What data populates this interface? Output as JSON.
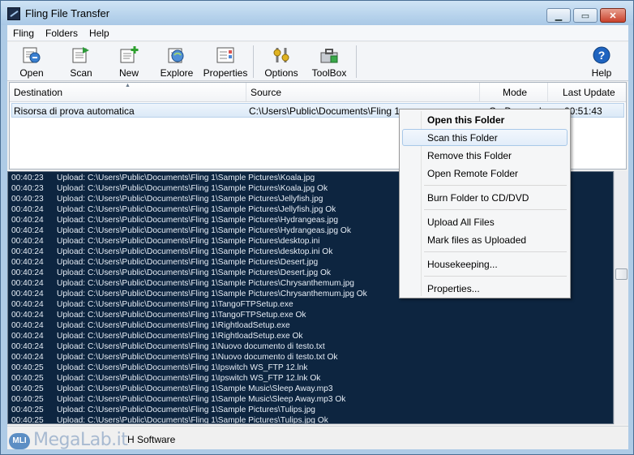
{
  "window": {
    "title": "Fling File Transfer",
    "minimize": "▁",
    "maximize": "▭",
    "close": "✕"
  },
  "menu": [
    "Fling",
    "Folders",
    "Help"
  ],
  "toolbar": {
    "open": "Open",
    "scan": "Scan",
    "new": "New",
    "explore": "Explore",
    "properties": "Properties",
    "options": "Options",
    "toolbox": "ToolBox",
    "help": "Help"
  },
  "folder_list": {
    "columns": [
      "Destination",
      "Source",
      "Mode",
      "Last Update"
    ],
    "rows": [
      {
        "destination": "Risorsa di prova automatica",
        "source": "C:\\Users\\Public\\Documents\\Fling 1",
        "mode": "On Demand",
        "last_update": "00:51:43"
      }
    ]
  },
  "log": [
    [
      "00:40:23",
      "Upload: C:\\Users\\Public\\Documents\\Fling 1\\Sample Pictures\\Koala.jpg"
    ],
    [
      "00:40:23",
      "Upload: C:\\Users\\Public\\Documents\\Fling 1\\Sample Pictures\\Koala.jpg Ok"
    ],
    [
      "00:40:23",
      "Upload: C:\\Users\\Public\\Documents\\Fling 1\\Sample Pictures\\Jellyfish.jpg"
    ],
    [
      "00:40:24",
      "Upload: C:\\Users\\Public\\Documents\\Fling 1\\Sample Pictures\\Jellyfish.jpg Ok"
    ],
    [
      "00:40:24",
      "Upload: C:\\Users\\Public\\Documents\\Fling 1\\Sample Pictures\\Hydrangeas.jpg"
    ],
    [
      "00:40:24",
      "Upload: C:\\Users\\Public\\Documents\\Fling 1\\Sample Pictures\\Hydrangeas.jpg Ok"
    ],
    [
      "00:40:24",
      "Upload: C:\\Users\\Public\\Documents\\Fling 1\\Sample Pictures\\desktop.ini"
    ],
    [
      "00:40:24",
      "Upload: C:\\Users\\Public\\Documents\\Fling 1\\Sample Pictures\\desktop.ini Ok"
    ],
    [
      "00:40:24",
      "Upload: C:\\Users\\Public\\Documents\\Fling 1\\Sample Pictures\\Desert.jpg"
    ],
    [
      "00:40:24",
      "Upload: C:\\Users\\Public\\Documents\\Fling 1\\Sample Pictures\\Desert.jpg Ok"
    ],
    [
      "00:40:24",
      "Upload: C:\\Users\\Public\\Documents\\Fling 1\\Sample Pictures\\Chrysanthemum.jpg"
    ],
    [
      "00:40:24",
      "Upload: C:\\Users\\Public\\Documents\\Fling 1\\Sample Pictures\\Chrysanthemum.jpg Ok"
    ],
    [
      "00:40:24",
      "Upload: C:\\Users\\Public\\Documents\\Fling 1\\TangoFTPSetup.exe"
    ],
    [
      "00:40:24",
      "Upload: C:\\Users\\Public\\Documents\\Fling 1\\TangoFTPSetup.exe Ok"
    ],
    [
      "00:40:24",
      "Upload: C:\\Users\\Public\\Documents\\Fling 1\\RightloadSetup.exe"
    ],
    [
      "00:40:24",
      "Upload: C:\\Users\\Public\\Documents\\Fling 1\\RightloadSetup.exe Ok"
    ],
    [
      "00:40:24",
      "Upload: C:\\Users\\Public\\Documents\\Fling 1\\Nuovo documento di testo.txt"
    ],
    [
      "00:40:24",
      "Upload: C:\\Users\\Public\\Documents\\Fling 1\\Nuovo documento di testo.txt Ok"
    ],
    [
      "00:40:25",
      "Upload: C:\\Users\\Public\\Documents\\Fling 1\\Ipswitch WS_FTP 12.lnk"
    ],
    [
      "00:40:25",
      "Upload: C:\\Users\\Public\\Documents\\Fling 1\\Ipswitch WS_FTP 12.lnk Ok"
    ],
    [
      "00:40:25",
      "Upload: C:\\Users\\Public\\Documents\\Fling 1\\Sample Music\\Sleep Away.mp3"
    ],
    [
      "00:40:25",
      "Upload: C:\\Users\\Public\\Documents\\Fling 1\\Sample Music\\Sleep Away.mp3 Ok"
    ],
    [
      "00:40:25",
      "Upload: C:\\Users\\Public\\Documents\\Fling 1\\Sample Pictures\\Tulips.jpg"
    ],
    [
      "00:40:25",
      "Upload: C:\\Users\\Public\\Documents\\Fling 1\\Sample Pictures\\Tulips.jpg Ok"
    ]
  ],
  "status": {
    "text": "H Software",
    "watermark": "MegaLab.it",
    "watermark_badge": "MLI"
  },
  "context_menu": {
    "items": [
      "Open this Folder",
      "Scan this Folder",
      "Remove this Folder",
      "Open Remote Folder",
      "Burn Folder to CD/DVD",
      "Upload All Files",
      "Mark files as Uploaded",
      "Housekeeping...",
      "Properties..."
    ]
  },
  "colors": {
    "log_bg": "#0d2540",
    "log_text": "#e6edf5",
    "title_bar": "#b7d3ec",
    "selection": "#dbe9f7"
  }
}
